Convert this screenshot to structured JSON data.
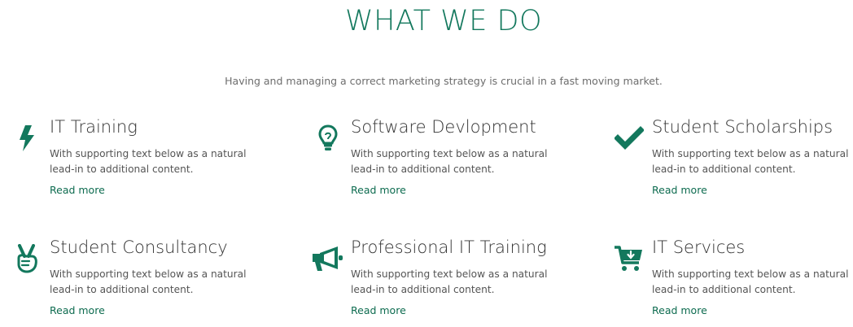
{
  "section": {
    "title": "WHAT WE DO",
    "subtitle": "Having and managing a correct marketing strategy is crucial in a fast moving market."
  },
  "colors": {
    "accent": "#13785d",
    "link": "#0d6b4f",
    "heading": "#333333",
    "body": "#555555"
  },
  "services": [
    {
      "icon": "lightning-bolt-icon",
      "title": "IT Training",
      "text": "With supporting text below as a natural lead-in to additional content.",
      "link": "Read more"
    },
    {
      "icon": "lightbulb-icon",
      "title": "Software Devlopment",
      "text": "With supporting text below as a natural lead-in to additional content.",
      "link": "Read more"
    },
    {
      "icon": "checkmark-icon",
      "title": "Student Scholarships",
      "text": "With supporting text below as a natural lead-in to additional content.",
      "link": "Read more"
    },
    {
      "icon": "peace-hand-icon",
      "title": "Student Consultancy",
      "text": "With supporting text below as a natural lead-in to additional content.",
      "link": "Read more"
    },
    {
      "icon": "megaphone-icon",
      "title": "Professional IT Training",
      "text": "With supporting text below as a natural lead-in to additional content.",
      "link": "Read more"
    },
    {
      "icon": "cart-download-icon",
      "title": "IT Services",
      "text": "With supporting text below as a natural lead-in to additional content.",
      "link": "Read more"
    }
  ]
}
